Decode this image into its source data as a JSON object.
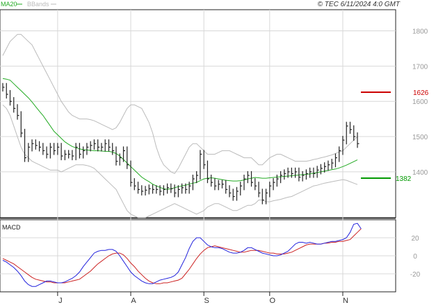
{
  "header": {
    "legend_ma": "MA20",
    "legend_bb": "BBands",
    "copyright": "© TEC 6/11/2024 4:0 GMT"
  },
  "colors": {
    "ma": "#22aa22",
    "bands": "#bbbbbb",
    "price": "#222222",
    "macd": "#2222dd",
    "signal": "#cc2222",
    "resistance": "#cc0000",
    "support": "#009900",
    "grid": "#d8d8d8",
    "axis_text": "#999999"
  },
  "chart_data": [
    {
      "type": "ohlc",
      "x_labels": [
        "J",
        "A",
        "S",
        "O",
        "N"
      ],
      "y_ticks": [
        1400,
        1500,
        1600,
        1700,
        1800
      ],
      "ylim": [
        1270,
        1860
      ],
      "grid": true,
      "lines": [
        {
          "label": "1626",
          "value": 1626,
          "role": "resistance"
        },
        {
          "label": "1382",
          "value": 1382,
          "role": "support"
        }
      ],
      "close": [
        1640,
        1620,
        1600,
        1580,
        1560,
        1510,
        1440,
        1470,
        1480,
        1475,
        1470,
        1460,
        1450,
        1470,
        1460,
        1470,
        1445,
        1450,
        1450,
        1445,
        1470,
        1450,
        1460,
        1470,
        1475,
        1480,
        1470,
        1470,
        1480,
        1470,
        1460,
        1430,
        1440,
        1460,
        1420,
        1370,
        1360,
        1350,
        1345,
        1348,
        1352,
        1350,
        1350,
        1345,
        1350,
        1355,
        1352,
        1340,
        1350,
        1355,
        1350,
        1360,
        1380,
        1390,
        1450,
        1420,
        1380,
        1370,
        1360,
        1365,
        1365,
        1350,
        1340,
        1330,
        1345,
        1360,
        1380,
        1390,
        1370,
        1360,
        1340,
        1320,
        1340,
        1360,
        1370,
        1380,
        1390,
        1395,
        1400,
        1395,
        1400,
        1385,
        1390,
        1395,
        1400,
        1395,
        1405,
        1410,
        1415,
        1420,
        1425,
        1440,
        1460,
        1490,
        1530,
        1520,
        1500,
        1480
      ],
      "ma20": [
        1665,
        1663,
        1660,
        1650,
        1640,
        1630,
        1620,
        1610,
        1598,
        1585,
        1572,
        1560,
        1545,
        1530,
        1515,
        1505,
        1495,
        1485,
        1478,
        1472,
        1468,
        1465,
        1463,
        1462,
        1461,
        1460,
        1460,
        1459,
        1458,
        1458,
        1456,
        1452,
        1445,
        1435,
        1425,
        1415,
        1405,
        1395,
        1385,
        1378,
        1372,
        1365,
        1360,
        1356,
        1352,
        1350,
        1352,
        1355,
        1358,
        1360,
        1362,
        1365,
        1368,
        1370,
        1375,
        1380,
        1382,
        1383,
        1382,
        1380,
        1378,
        1376,
        1375,
        1374,
        1374,
        1375,
        1377,
        1380,
        1382,
        1384,
        1383,
        1382,
        1382,
        1383,
        1384,
        1385,
        1386,
        1387,
        1388,
        1389,
        1390,
        1391,
        1392,
        1393,
        1394,
        1396,
        1398,
        1400,
        1402,
        1404,
        1406,
        1408,
        1411,
        1415,
        1419,
        1424,
        1429,
        1434
      ],
      "bb_upper": [
        1730,
        1750,
        1770,
        1780,
        1790,
        1790,
        1780,
        1770,
        1760,
        1740,
        1720,
        1700,
        1680,
        1660,
        1640,
        1620,
        1600,
        1585,
        1570,
        1560,
        1555,
        1550,
        1550,
        1550,
        1548,
        1545,
        1540,
        1535,
        1530,
        1525,
        1520,
        1525,
        1540,
        1560,
        1580,
        1590,
        1590,
        1585,
        1580,
        1560,
        1540,
        1510,
        1470,
        1440,
        1420,
        1410,
        1400,
        1395,
        1410,
        1430,
        1450,
        1470,
        1480,
        1480,
        1470,
        1460,
        1450,
        1450,
        1450,
        1455,
        1460,
        1460,
        1460,
        1455,
        1450,
        1445,
        1440,
        1440,
        1440,
        1430,
        1420,
        1420,
        1430,
        1440,
        1445,
        1450,
        1450,
        1445,
        1440,
        1435,
        1430,
        1430,
        1430,
        1430,
        1432,
        1435,
        1437,
        1440,
        1442,
        1445,
        1448,
        1452,
        1456,
        1460,
        1470,
        1480,
        1490,
        1500
      ],
      "bb_lower": [
        1590,
        1580,
        1560,
        1530,
        1500,
        1470,
        1450,
        1440,
        1430,
        1425,
        1420,
        1415,
        1410,
        1405,
        1405,
        1405,
        1400,
        1405,
        1410,
        1415,
        1420,
        1420,
        1420,
        1418,
        1415,
        1410,
        1400,
        1390,
        1380,
        1370,
        1360,
        1350,
        1330,
        1310,
        1290,
        1280,
        1275,
        1270,
        1270,
        1270,
        1275,
        1280,
        1285,
        1290,
        1295,
        1300,
        1305,
        1310,
        1305,
        1300,
        1295,
        1290,
        1285,
        1280,
        1285,
        1290,
        1300,
        1305,
        1310,
        1310,
        1305,
        1300,
        1295,
        1290,
        1290,
        1295,
        1300,
        1305,
        1305,
        1310,
        1320,
        1320,
        1315,
        1315,
        1318,
        1320,
        1322,
        1325,
        1328,
        1330,
        1335,
        1340,
        1345,
        1350,
        1355,
        1360,
        1362,
        1365,
        1368,
        1370,
        1372,
        1374,
        1376,
        1378,
        1376,
        1372,
        1368,
        1364
      ]
    },
    {
      "type": "line",
      "title": "MACD",
      "y_ticks": [
        20,
        0,
        -20
      ],
      "ylim": [
        -40,
        40
      ],
      "series": [
        {
          "values": [
            -5,
            -7,
            -10,
            -13,
            -17,
            -22,
            -28,
            -32,
            -34,
            -34,
            -32,
            -30,
            -28,
            -28,
            -29,
            -30,
            -30,
            -29,
            -27,
            -25,
            -22,
            -18,
            -12,
            -7,
            -2,
            3,
            5,
            6,
            6,
            7,
            7,
            5,
            0,
            -6,
            -12,
            -18,
            -22,
            -25,
            -28,
            -30,
            -31,
            -31,
            -29,
            -27,
            -26,
            -25,
            -24,
            -22,
            -18,
            -10,
            -2,
            8,
            16,
            20,
            20,
            16,
            12,
            10,
            9,
            9,
            8,
            6,
            4,
            3,
            3,
            4,
            6,
            9,
            9,
            7,
            5,
            3,
            2,
            1,
            0,
            0,
            1,
            3,
            5,
            9,
            13,
            15,
            15,
            14,
            15,
            14,
            13,
            13,
            14,
            15,
            16,
            16,
            17,
            18,
            20,
            26,
            35,
            36,
            30
          ]
        },
        {
          "values": [
            -3,
            -5,
            -7,
            -9,
            -12,
            -15,
            -18,
            -21,
            -24,
            -26,
            -27,
            -28,
            -29,
            -29,
            -30,
            -30,
            -30,
            -30,
            -29,
            -28,
            -27,
            -26,
            -23,
            -20,
            -17,
            -13,
            -9,
            -6,
            -3,
            0,
            2,
            3,
            3,
            1,
            -3,
            -8,
            -12,
            -17,
            -21,
            -25,
            -28,
            -30,
            -31,
            -31,
            -30,
            -30,
            -29,
            -28,
            -27,
            -25,
            -20,
            -15,
            -9,
            -3,
            2,
            6,
            9,
            10,
            11,
            10,
            9,
            8,
            7,
            6,
            5,
            4,
            4,
            5,
            6,
            6,
            6,
            5,
            4,
            3,
            3,
            2,
            2,
            2,
            3,
            4,
            6,
            8,
            10,
            12,
            13,
            13,
            13,
            13,
            14,
            14,
            15,
            15,
            16,
            16,
            17,
            18,
            22,
            26,
            30
          ]
        }
      ]
    }
  ]
}
